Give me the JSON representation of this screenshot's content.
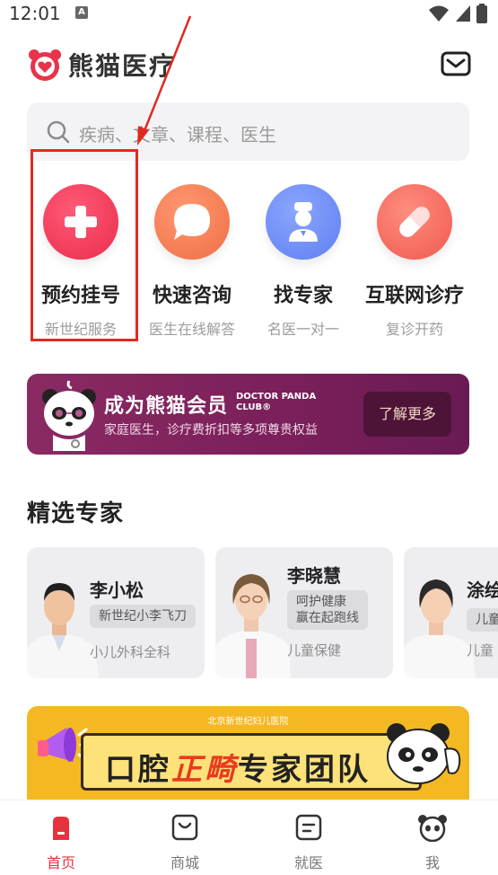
{
  "status_bar": {
    "time": "12:01",
    "notification_badge": "A"
  },
  "header": {
    "app_name": "熊猫医疗"
  },
  "search": {
    "placeholder": "疾病、文章、课程、医生"
  },
  "services": [
    {
      "title": "预约挂号",
      "subtitle": "新世纪服务",
      "icon": "plus-icon",
      "color": "#f0365a"
    },
    {
      "title": "快速咨询",
      "subtitle": "医生在线解答",
      "icon": "chat-bubble-icon",
      "color": "#f47a4f"
    },
    {
      "title": "找专家",
      "subtitle": "名医一对一",
      "icon": "doctor-icon",
      "color": "#6b8cf6"
    },
    {
      "title": "互联网诊疗",
      "subtitle": "复诊开药",
      "icon": "pill-icon",
      "color": "#f46a63"
    }
  ],
  "vip": {
    "title": "成为熊猫会员",
    "brand_line1": "DOCTOR PANDA",
    "brand_line2": "CLUB®",
    "description": "家庭医生，诊疗费折扣等多项尊贵权益",
    "button": "了解更多"
  },
  "experts_section": {
    "title": "精选专家"
  },
  "experts": [
    {
      "name": "李小松",
      "tag": "新世纪小李飞刀",
      "dept": "小儿外科全科"
    },
    {
      "name": "李晓慧",
      "tag_line1": "呵护健康",
      "tag_line2": "赢在起跑线",
      "dept": "儿童保健"
    },
    {
      "name": "涂绘",
      "tag": "儿童",
      "dept": "儿童"
    }
  ],
  "banner": {
    "hospital": "北京新世纪妇儿医院",
    "text_part1": "口腔",
    "text_highlight": "正畸",
    "text_part2": "专家团队"
  },
  "tabs": [
    {
      "label": "首页",
      "icon": "home-icon",
      "active": true
    },
    {
      "label": "商城",
      "icon": "shop-bag-icon",
      "active": false
    },
    {
      "label": "就医",
      "icon": "clinic-icon",
      "active": false
    },
    {
      "label": "我",
      "icon": "panda-profile-icon",
      "active": false
    }
  ],
  "colors": {
    "accent": "#e6323e",
    "highlight_box": "#e02a20",
    "vip_bg": "#7a1f5a",
    "banner_bg": "#f4b823"
  }
}
